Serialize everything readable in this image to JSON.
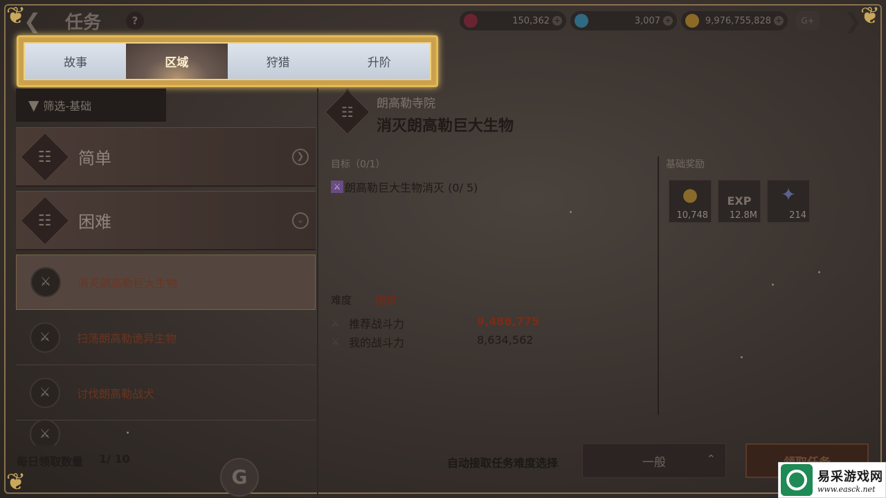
{
  "header": {
    "title": "任务",
    "help": "?",
    "currencies": [
      {
        "name": "ruby",
        "value": "150,362",
        "plus": "+"
      },
      {
        "name": "diamond",
        "value": "3,007",
        "plus": "+"
      },
      {
        "name": "gold",
        "value": "9,976,755,828",
        "plus": "+"
      }
    ],
    "extra_badge": "G+"
  },
  "tabs": [
    {
      "label": "故事",
      "active": false
    },
    {
      "label": "区域",
      "active": true
    },
    {
      "label": "狩猎",
      "active": false
    },
    {
      "label": "升阶",
      "active": false
    }
  ],
  "filter": {
    "label": "筛选-基础"
  },
  "categories": [
    {
      "label": "简单"
    },
    {
      "label": "困难"
    }
  ],
  "quests": [
    {
      "label": "消灭朗高勒巨大生物",
      "selected": true
    },
    {
      "label": "扫荡朗高勒诡异生物",
      "selected": false
    },
    {
      "label": "讨伐朗高勒战犬",
      "selected": false
    }
  ],
  "daily": {
    "label": "每日领取数量",
    "count": "1/ 10"
  },
  "detail": {
    "region": "朗高勒寺院",
    "title": "消灭朗高勒巨大生物",
    "objective_label": "目标（0/1）",
    "objective_item": "朗高勒巨大生物消灭 (0/ 5)",
    "reward_title": "基础奖励",
    "rewards": [
      {
        "icon": "gold-coins-icon",
        "value": "10,748"
      },
      {
        "icon": "exp-icon",
        "label": "EXP",
        "value": "12.8M"
      },
      {
        "icon": "orb-icon",
        "value": "214"
      }
    ],
    "difficulty_label": "难度",
    "difficulty_value": "困难",
    "recommended_power_label": "推荐战斗力",
    "recommended_power": "9,486,775",
    "my_power_label": "我的战斗力",
    "my_power": "8,634,562"
  },
  "footer": {
    "auto_label": "自动接取任务难度选择",
    "difficulty_select": "一般",
    "accept_button": "领取任务"
  },
  "watermark": {
    "name": "易采游戏网",
    "url": "www.easck.net"
  }
}
